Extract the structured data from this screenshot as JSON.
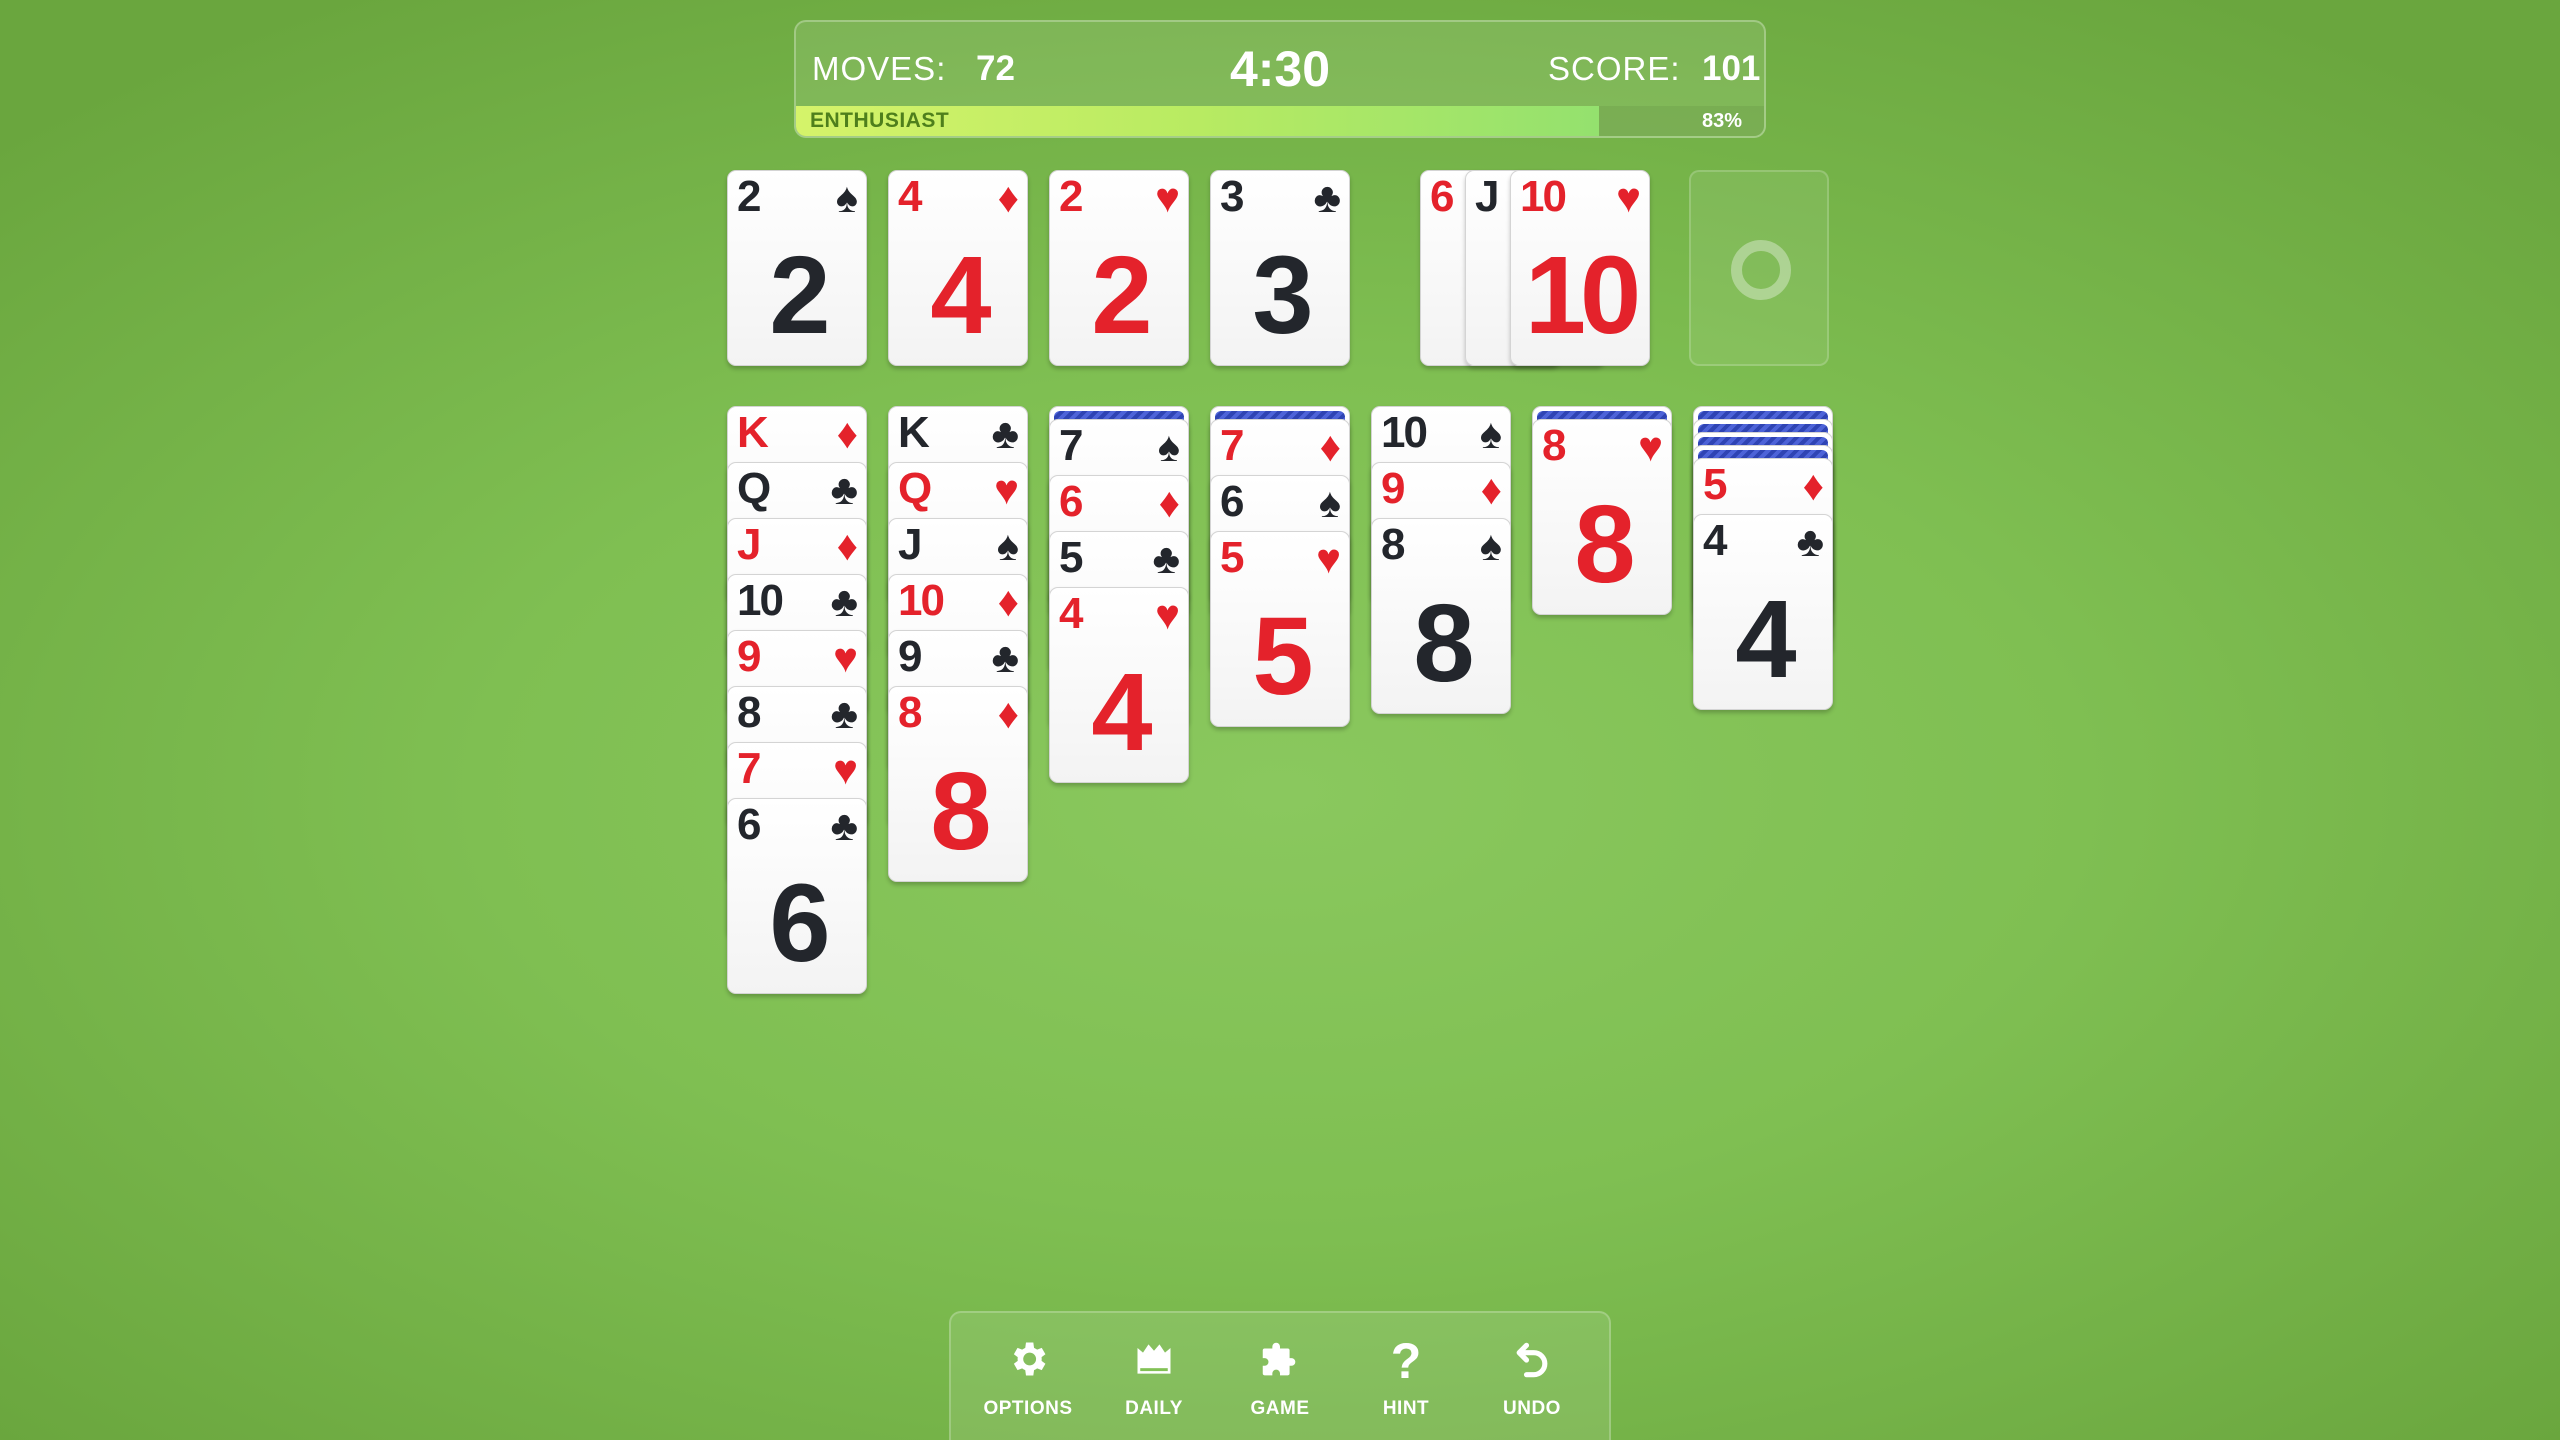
{
  "hud": {
    "moves_label": "MOVES:",
    "moves": "72",
    "timer": "4:30",
    "score_label": "SCORE:",
    "score": "101",
    "rank_label": "ENTHUSIAST",
    "progress_percent": 83,
    "progress_text": "83%"
  },
  "colors": {
    "felt": "#7fbf52",
    "red_suit": "#e4222b",
    "black_suit": "#23262c",
    "card_back": "#3a50c4",
    "progress_fill": "#b8eb62"
  },
  "foundations": [
    {
      "rank": "2",
      "suit": "♠",
      "color": "black"
    },
    {
      "rank": "4",
      "suit": "♦",
      "color": "red"
    },
    {
      "rank": "2",
      "suit": "♥",
      "color": "red"
    },
    {
      "rank": "3",
      "suit": "♣",
      "color": "black"
    }
  ],
  "waste": [
    {
      "rank": "6",
      "suit": "♦",
      "color": "red"
    },
    {
      "rank": "J",
      "suit": "♣",
      "color": "black"
    },
    {
      "rank": "10",
      "suit": "♥",
      "color": "red"
    }
  ],
  "stock": {
    "empty": true,
    "icon": "recycle-ring-icon"
  },
  "tableau": [
    {
      "hidden": 0,
      "cards": [
        {
          "rank": "K",
          "suit": "♦",
          "color": "red"
        },
        {
          "rank": "Q",
          "suit": "♣",
          "color": "black"
        },
        {
          "rank": "J",
          "suit": "♦",
          "color": "red"
        },
        {
          "rank": "10",
          "suit": "♣",
          "color": "black"
        },
        {
          "rank": "9",
          "suit": "♥",
          "color": "red"
        },
        {
          "rank": "8",
          "suit": "♣",
          "color": "black"
        },
        {
          "rank": "7",
          "suit": "♥",
          "color": "red"
        },
        {
          "rank": "6",
          "suit": "♣",
          "color": "black"
        }
      ]
    },
    {
      "hidden": 0,
      "cards": [
        {
          "rank": "K",
          "suit": "♣",
          "color": "black"
        },
        {
          "rank": "Q",
          "suit": "♥",
          "color": "red"
        },
        {
          "rank": "J",
          "suit": "♠",
          "color": "black"
        },
        {
          "rank": "10",
          "suit": "♦",
          "color": "red"
        },
        {
          "rank": "9",
          "suit": "♣",
          "color": "black"
        },
        {
          "rank": "8",
          "suit": "♦",
          "color": "red"
        }
      ]
    },
    {
      "hidden": 1,
      "cards": [
        {
          "rank": "7",
          "suit": "♠",
          "color": "black"
        },
        {
          "rank": "6",
          "suit": "♦",
          "color": "red"
        },
        {
          "rank": "5",
          "suit": "♣",
          "color": "black"
        },
        {
          "rank": "4",
          "suit": "♥",
          "color": "red"
        }
      ]
    },
    {
      "hidden": 1,
      "cards": [
        {
          "rank": "7",
          "suit": "♦",
          "color": "red"
        },
        {
          "rank": "6",
          "suit": "♠",
          "color": "black"
        },
        {
          "rank": "5",
          "suit": "♥",
          "color": "red"
        }
      ]
    },
    {
      "hidden": 0,
      "cards": [
        {
          "rank": "10",
          "suit": "♠",
          "color": "black"
        },
        {
          "rank": "9",
          "suit": "♦",
          "color": "red"
        },
        {
          "rank": "8",
          "suit": "♠",
          "color": "black"
        }
      ]
    },
    {
      "hidden": 1,
      "cards": [
        {
          "rank": "8",
          "suit": "♥",
          "color": "red"
        }
      ]
    },
    {
      "hidden": 4,
      "cards": [
        {
          "rank": "5",
          "suit": "♦",
          "color": "red"
        },
        {
          "rank": "4",
          "suit": "♣",
          "color": "black"
        }
      ]
    }
  ],
  "toolbar": [
    {
      "label": "OPTIONS",
      "icon": "gear-icon"
    },
    {
      "label": "DAILY",
      "icon": "crown-calendar-icon"
    },
    {
      "label": "GAME",
      "icon": "puzzle-icon"
    },
    {
      "label": "HINT",
      "icon": "question-icon"
    },
    {
      "label": "UNDO",
      "icon": "undo-icon"
    }
  ]
}
